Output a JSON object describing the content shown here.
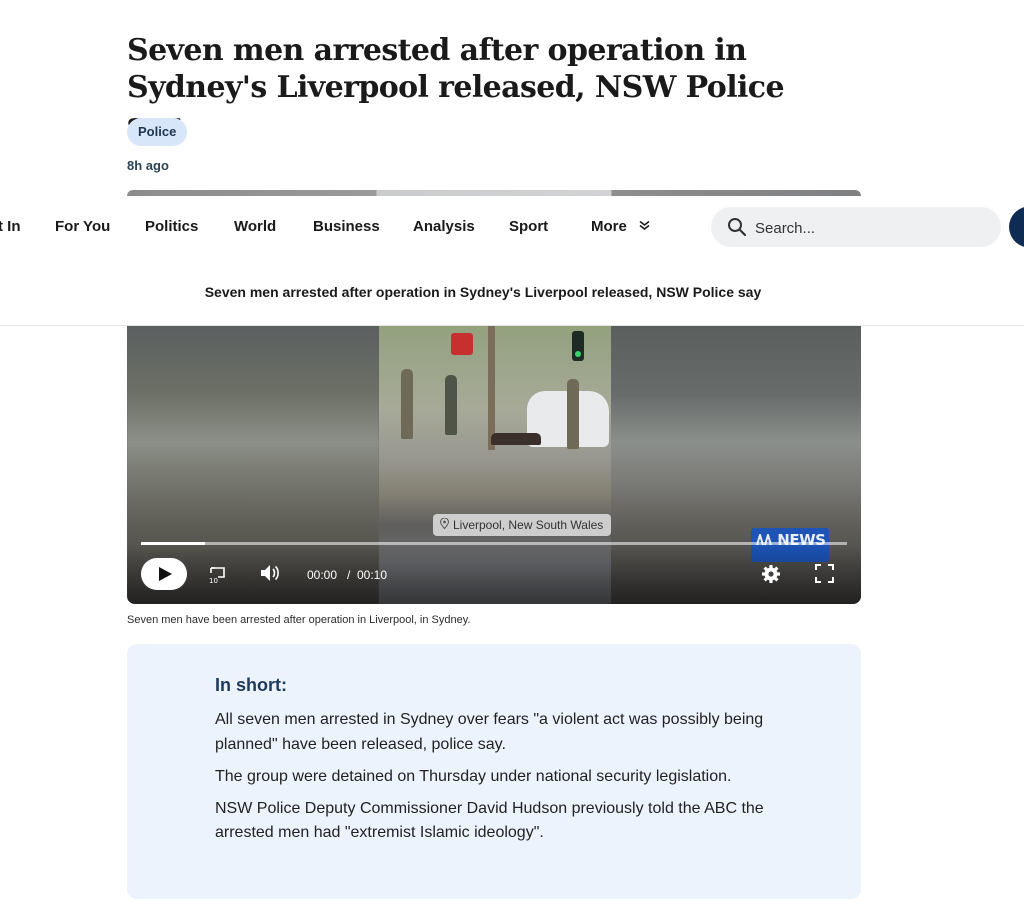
{
  "article": {
    "headline": "Seven men arrested after operation in Sydney's Liverpool released, NSW Police say",
    "tag": "Police",
    "time": "8h ago"
  },
  "nav": {
    "items": [
      {
        "label": "t In"
      },
      {
        "label": "For You"
      },
      {
        "label": "Politics"
      },
      {
        "label": "World"
      },
      {
        "label": "Business"
      },
      {
        "label": "Analysis"
      },
      {
        "label": "Sport"
      },
      {
        "label": "More"
      }
    ],
    "search_placeholder": "Search...",
    "sticky_title": "Seven men arrested after operation in Sydney's Liverpool released, NSW Police say"
  },
  "video": {
    "location": "Liverpool, New South Wales",
    "brand": "NEWS",
    "current_time": "00:00",
    "separator": "/",
    "duration": "00:10",
    "progress": 0.09,
    "caption": "Seven men have been arrested after operation in Liverpool, in Sydney."
  },
  "summary": {
    "title": "In short:",
    "points": [
      "All seven men arrested in Sydney over fears \"a violent act was possibly being planned\" have been released, police say.",
      "The group were detained on Thursday under national security legislation.",
      "NSW Police Deputy Commissioner David Hudson previously told the ABC the arrested men had \"extremist Islamic ideology\"."
    ]
  },
  "colors": {
    "tag_bg": "#d7e6f9",
    "summary_bg": "#edf3fc",
    "summary_title": "#1d3a5e",
    "brand_blue": "#1854be",
    "nav_button": "#0e2b54"
  },
  "icons": [
    "search-icon",
    "chevron-double-down-icon",
    "play-icon",
    "replay-10-icon",
    "volume-icon",
    "settings-icon",
    "fullscreen-icon",
    "location-pin-icon",
    "abc-logo-icon"
  ]
}
